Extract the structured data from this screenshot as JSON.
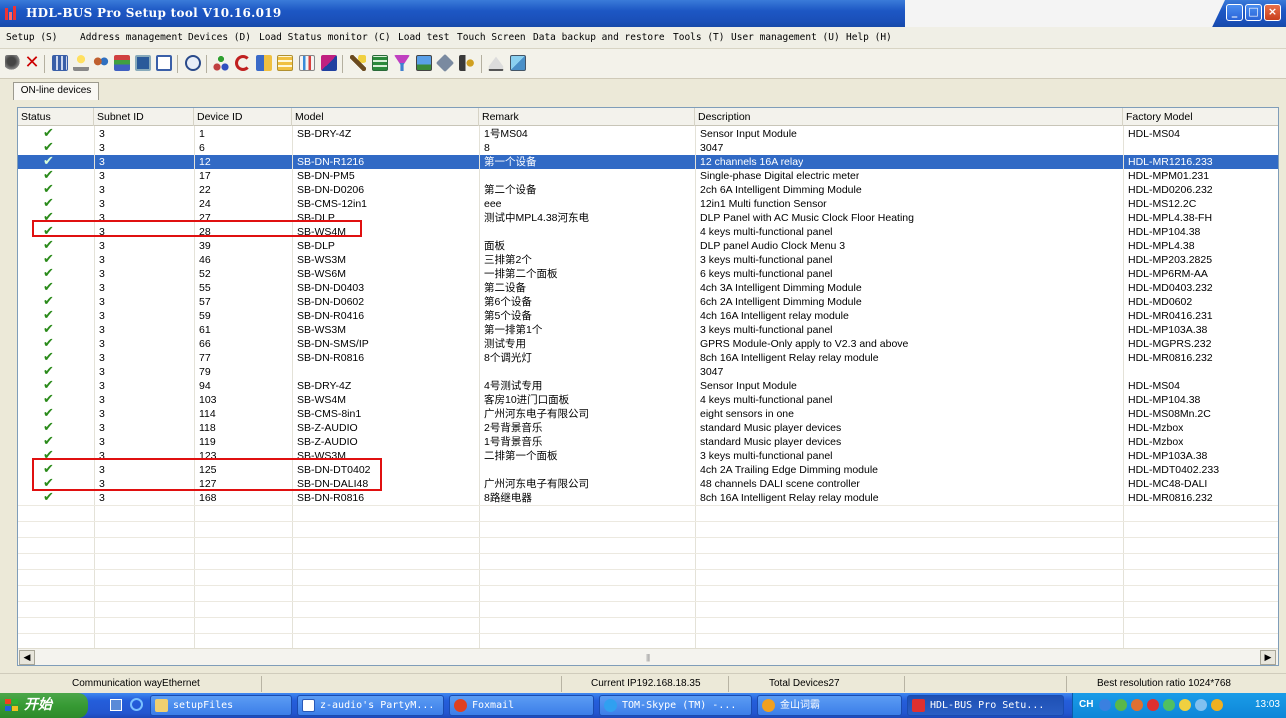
{
  "window": {
    "title": "HDL-BUS Pro Setup tool V10.16.019",
    "minimize": "_",
    "maximize": "□",
    "close": "×"
  },
  "menu": [
    "Setup (S)",
    "Address management",
    "Devices (D)",
    "Load Status monitor (C)",
    "Load test",
    "Touch Screen",
    "Data backup and restore",
    "Tools (T)",
    "User management (U)",
    "Help (H)"
  ],
  "toolbar_icons": [
    "find-icon",
    "delete-icon",
    "grid-icon",
    "bulb-icon",
    "user-group-icon",
    "network-icon",
    "monitor-icon",
    "window-icon",
    "clock-icon",
    "tree-icon",
    "refresh-icon",
    "devices-icon",
    "calendar-icon",
    "chart-icon",
    "flag-icon",
    "wand-icon",
    "table-icon",
    "funnel-icon",
    "image-icon",
    "tag-icon",
    "speaker-icon",
    "eject-icon",
    "picture-icon"
  ],
  "tab": {
    "label": "ON-line devices"
  },
  "columns": [
    "Status",
    "Subnet ID",
    "Device ID",
    "Model",
    "Remark",
    "Description",
    "Factory Model"
  ],
  "rows": [
    {
      "status": "✔",
      "subnet": "3",
      "device": "1",
      "model": "SB-DRY-4Z",
      "remark": "1号MS04",
      "description": "Sensor Input Module",
      "factory": "HDL-MS04"
    },
    {
      "status": "✔",
      "subnet": "3",
      "device": "6",
      "model": "",
      "remark": "8",
      "description": "3047",
      "factory": ""
    },
    {
      "status": "✔",
      "subnet": "3",
      "device": "12",
      "model": "SB-DN-R1216",
      "remark": "第一个设备",
      "description": "12 channels 16A relay",
      "factory": "HDL-MR1216.233"
    },
    {
      "status": "✔",
      "subnet": "3",
      "device": "17",
      "model": "SB-DN-PM5",
      "remark": "",
      "description": "Single-phase Digital electric meter",
      "factory": "HDL-MPM01.231"
    },
    {
      "status": "✔",
      "subnet": "3",
      "device": "22",
      "model": "SB-DN-D0206",
      "remark": "第二个设备",
      "description": "2ch 6A Intelligent Dimming Module",
      "factory": "HDL-MD0206.232"
    },
    {
      "status": "✔",
      "subnet": "3",
      "device": "24",
      "model": "SB-CMS-12in1",
      "remark": "eee",
      "description": "12in1 Multi function Sensor",
      "factory": "HDL-MS12.2C"
    },
    {
      "status": "✔",
      "subnet": "3",
      "device": "27",
      "model": "SB-DLP",
      "remark": "测试中MPL4.38河东电",
      "description": "DLP Panel with AC Music Clock Floor Heating",
      "factory": "HDL-MPL4.38-FH"
    },
    {
      "status": "✔",
      "subnet": "3",
      "device": "28",
      "model": "SB-WS4M",
      "remark": "",
      "description": "4 keys multi-functional panel",
      "factory": "HDL-MP104.38"
    },
    {
      "status": "✔",
      "subnet": "3",
      "device": "39",
      "model": "SB-DLP",
      "remark": "面板",
      "description": "DLP panel Audio Clock Menu 3",
      "factory": "HDL-MPL4.38"
    },
    {
      "status": "✔",
      "subnet": "3",
      "device": "46",
      "model": "SB-WS3M",
      "remark": "三排第2个",
      "description": "3 keys multi-functional panel",
      "factory": "HDL-MP203.2825"
    },
    {
      "status": "✔",
      "subnet": "3",
      "device": "52",
      "model": "SB-WS6M",
      "remark": "一排第二个面板",
      "description": "6 keys multi-functional panel",
      "factory": "HDL-MP6RM-AA"
    },
    {
      "status": "✔",
      "subnet": "3",
      "device": "55",
      "model": "SB-DN-D0403",
      "remark": "第二设备",
      "description": "4ch 3A Intelligent Dimming Module",
      "factory": "HDL-MD0403.232"
    },
    {
      "status": "✔",
      "subnet": "3",
      "device": "57",
      "model": "SB-DN-D0602",
      "remark": "第6个设备",
      "description": "6ch 2A Intelligent Dimming Module",
      "factory": "HDL-MD0602"
    },
    {
      "status": "✔",
      "subnet": "3",
      "device": "59",
      "model": "SB-DN-R0416",
      "remark": "第5个设备",
      "description": "4ch 16A Intelligent  relay module",
      "factory": "HDL-MR0416.231"
    },
    {
      "status": "✔",
      "subnet": "3",
      "device": "61",
      "model": "SB-WS3M",
      "remark": "第一排第1个",
      "description": "3 keys multi-functional panel",
      "factory": "HDL-MP103A.38"
    },
    {
      "status": "✔",
      "subnet": "3",
      "device": "66",
      "model": "SB-DN-SMS/IP",
      "remark": "测试专用",
      "description": "GPRS Module-Only apply to V2.3 and above",
      "factory": "HDL-MGPRS.232"
    },
    {
      "status": "✔",
      "subnet": "3",
      "device": "77",
      "model": "SB-DN-R0816",
      "remark": "8个调光灯",
      "description": "8ch 16A Intelligent Relay relay module",
      "factory": "HDL-MR0816.232"
    },
    {
      "status": "✔",
      "subnet": "3",
      "device": "79",
      "model": "",
      "remark": "",
      "description": "3047",
      "factory": ""
    },
    {
      "status": "✔",
      "subnet": "3",
      "device": "94",
      "model": "SB-DRY-4Z",
      "remark": "4号测试专用",
      "description": "Sensor Input Module",
      "factory": "HDL-MS04"
    },
    {
      "status": "✔",
      "subnet": "3",
      "device": "103",
      "model": "SB-WS4M",
      "remark": "客房10进门口面板",
      "description": "4 keys multi-functional panel",
      "factory": "HDL-MP104.38"
    },
    {
      "status": "✔",
      "subnet": "3",
      "device": "114",
      "model": "SB-CMS-8in1",
      "remark": "广州河东电子有限公司",
      "description": "eight sensors in one",
      "factory": "HDL-MS08Mn.2C"
    },
    {
      "status": "✔",
      "subnet": "3",
      "device": "118",
      "model": "SB-Z-AUDIO",
      "remark": "2号背景音乐",
      "description": "standard Music player devices",
      "factory": "HDL-Mzbox"
    },
    {
      "status": "✔",
      "subnet": "3",
      "device": "119",
      "model": "SB-Z-AUDIO",
      "remark": "1号背景音乐",
      "description": "standard Music player devices",
      "factory": "HDL-Mzbox"
    },
    {
      "status": "✔",
      "subnet": "3",
      "device": "123",
      "model": "SB-WS3M",
      "remark": "二排第一个面板",
      "description": "3 keys multi-functional panel",
      "factory": "HDL-MP103A.38"
    },
    {
      "status": "✔",
      "subnet": "3",
      "device": "125",
      "model": "SB-DN-DT0402",
      "remark": "",
      "description": "4ch 2A Trailing Edge Dimming module",
      "factory": "HDL-MDT0402.233"
    },
    {
      "status": "✔",
      "subnet": "3",
      "device": "127",
      "model": "SB-DN-DALI48",
      "remark": "广州河东电子有限公司",
      "description": "48 channels DALI scene controller",
      "factory": "HDL-MC48-DALI"
    },
    {
      "status": "✔",
      "subnet": "3",
      "device": "168",
      "model": "SB-DN-R0816",
      "remark": "8路继电器",
      "description": "8ch 16A Intelligent Relay relay module",
      "factory": "HDL-MR0816.232"
    }
  ],
  "selected_row_index": 2,
  "statusbar": {
    "comm": "Communication wayEthernet",
    "ip": "Current IP192.168.18.35",
    "total": "Total Devices27",
    "resolution": "Best resolution ratio  1024*768"
  },
  "taskbar": {
    "start": "开始",
    "tasks": [
      "setupFiles",
      "z-audio's PartyM...",
      "Foxmail",
      "TOM-Skype (TM) -...",
      "金山词霸",
      "HDL-BUS Pro Setu..."
    ],
    "lang": "CH",
    "clock": "13:03"
  },
  "colors": {
    "selected_row": "#316ac5",
    "highlight_box": "#e01010",
    "check": "#2a8a1a",
    "titlebar": "#1d57c4"
  }
}
